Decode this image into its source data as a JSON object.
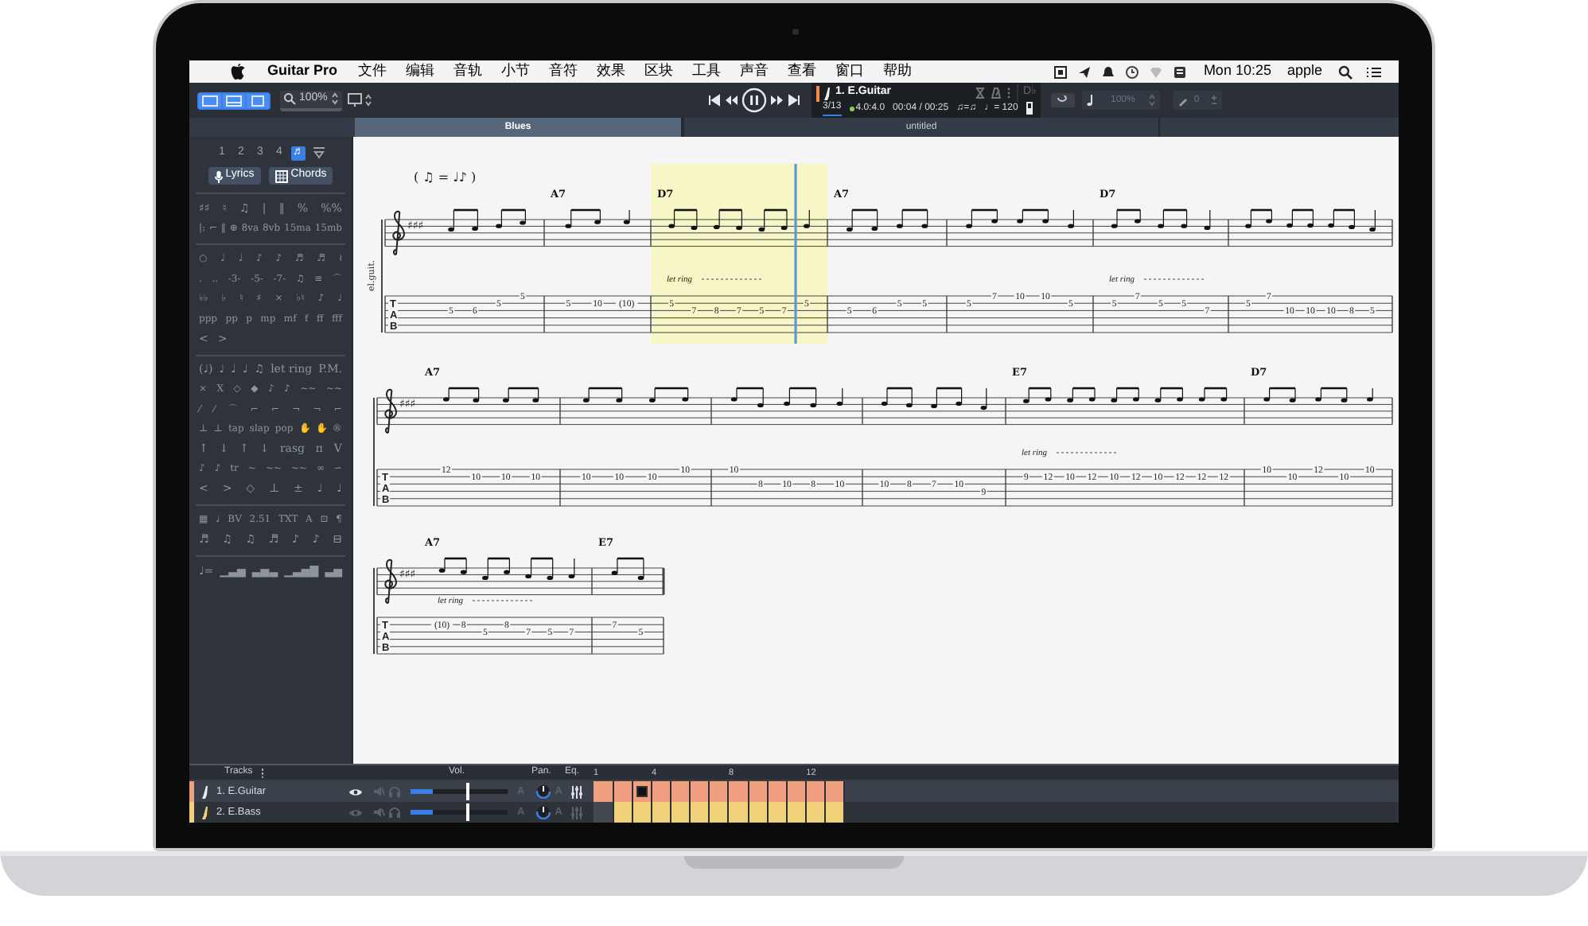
{
  "menubar": {
    "menus": [
      {
        "label": "Guitar Pro",
        "kind": "app"
      },
      {
        "label": "文件",
        "kind": "menu"
      },
      {
        "label": "编辑",
        "kind": "menu"
      },
      {
        "label": "音轨",
        "kind": "menu"
      },
      {
        "label": "小节",
        "kind": "menu"
      },
      {
        "label": "音符",
        "kind": "menu"
      },
      {
        "label": "效果",
        "kind": "menu"
      },
      {
        "label": "区块",
        "kind": "menu"
      },
      {
        "label": "工具",
        "kind": "menu"
      },
      {
        "label": "声音",
        "kind": "menu"
      },
      {
        "label": "查看",
        "kind": "menu"
      },
      {
        "label": "窗口",
        "kind": "menu"
      },
      {
        "label": "帮助",
        "kind": "menu"
      }
    ],
    "clock": "Mon 10:25",
    "user": "apple"
  },
  "toolbar": {
    "zoom": "100%",
    "track": {
      "name": "1. E.Guitar",
      "bar": "3/13",
      "signature": "4.0:4.0",
      "time": "00:04 / 00:25",
      "feel": "♫=♫",
      "tempo": "♩= 120",
      "key": "D♭"
    },
    "speed": "100%",
    "pitch": "0"
  },
  "tabs": [
    {
      "label": "Blues",
      "selected": true
    },
    {
      "label": "untitled",
      "selected": false
    }
  ],
  "palette": {
    "voices": [
      {
        "label": "1",
        "selected": false
      },
      {
        "label": "2",
        "selected": false
      },
      {
        "label": "3",
        "selected": false
      },
      {
        "label": "4",
        "selected": false
      },
      {
        "label": "♬",
        "selected": true
      }
    ],
    "buttons": [
      "Lyrics",
      "Chords"
    ],
    "groups": [
      [
        [
          "♯♯",
          "♮",
          "♫",
          "|",
          "‖",
          "%",
          "%%"
        ],
        [
          "|:",
          "⌐",
          "‖",
          "⊕",
          "8va",
          "8vb",
          "15ma",
          "15mb"
        ]
      ],
      [
        [
          "○",
          "♩",
          "♩",
          "♪",
          "♪",
          "♬",
          "♬",
          "≀"
        ],
        [
          ".",
          "..",
          "-3-",
          "-5-",
          "-7-",
          "♫",
          "≡",
          "⌒"
        ],
        [
          "♭♭",
          "♭",
          "♮",
          "♯",
          "×",
          "♭♮",
          "♪",
          "♩"
        ],
        [
          "ppp",
          "pp",
          "p",
          "mp",
          "mf",
          "f",
          "ff",
          "fff"
        ],
        [
          "<",
          ">"
        ]
      ],
      [
        [
          "(♩)",
          "♩",
          "♩",
          "♩",
          "♫",
          "let ring",
          "P.M."
        ],
        [
          "×",
          "X",
          "◇",
          "◆",
          "♪",
          "♪",
          "~~",
          "~~"
        ],
        [
          "⁄",
          "⁄",
          "⌒",
          "⌐",
          "⌐",
          "¬",
          "¬",
          "⌐"
        ],
        [
          "⊥",
          "⊥",
          "tap",
          "slap",
          "pop",
          "✋",
          "✋",
          "®"
        ],
        [
          "↑",
          "↓",
          "↑",
          "↓",
          "rasg",
          "п",
          "V"
        ],
        [
          "♪",
          "♪",
          "tr",
          "~",
          "~~",
          "~~",
          "∞",
          "∽"
        ],
        [
          "<",
          ">",
          "◇",
          "⊥",
          "±",
          "♩",
          "♩"
        ]
      ],
      [
        [
          "▦",
          "♩",
          "BV",
          "2.51",
          "TXT",
          "A",
          "⊡",
          "¶"
        ],
        [
          "♬",
          "♫",
          "♫",
          "♬",
          "♪",
          "♪",
          "⊟"
        ]
      ],
      [
        [
          "♩=",
          "▁▃▅",
          "▃▅▃",
          "▁▃▅▇",
          "▃▅"
        ]
      ]
    ]
  },
  "score": {
    "swing_mark": "( ♫ = ♩♪ )",
    "instrument_label": "el.guit.",
    "systems": [
      {
        "key_signature": "♯♯♯",
        "tab_clef": [
          "T",
          "A",
          "B"
        ],
        "measures": [
          {
            "selected": false,
            "playhead": false,
            "notes": [
              {
                "kind": "third",
                "fret": "5"
              },
              {
                "kind": "third",
                "fret": "6"
              },
              {
                "kind": "second",
                "fret": "5"
              },
              {
                "kind": "first",
                "fret": "5"
              }
            ]
          },
          {
            "chord": "A7",
            "selected": false,
            "playhead": false,
            "notes": [
              {
                "kind": "second",
                "fret": "5"
              },
              {
                "kind": "second",
                "fret": "10"
              },
              {
                "kind": "second",
                "fret": "(10)"
              }
            ]
          },
          {
            "chord": "D7",
            "annotation": "let ring",
            "selected": true,
            "playhead": true,
            "notes": [
              {
                "kind": "second",
                "fret": "5"
              },
              {
                "kind": "third",
                "fret": "7"
              },
              {
                "kind": "third",
                "fret": "8"
              },
              {
                "kind": "third",
                "fret": "7"
              },
              {
                "kind": "third",
                "fret": "5"
              },
              {
                "kind": "third",
                "fret": "7"
              },
              {
                "kind": "second",
                "fret": "5"
              }
            ]
          },
          {
            "chord": "A7",
            "selected": false,
            "playhead": false,
            "notes": [
              {
                "kind": "third",
                "fret": "5"
              },
              {
                "kind": "third",
                "fret": "6"
              },
              {
                "kind": "second",
                "fret": "5"
              },
              {
                "kind": "second",
                "fret": "5"
              }
            ]
          },
          {
            "selected": false,
            "playhead": false,
            "notes": [
              {
                "kind": "second",
                "fret": "5"
              },
              {
                "kind": "first",
                "fret": "7"
              },
              {
                "kind": "first",
                "fret": "10"
              },
              {
                "kind": "first",
                "fret": "10"
              },
              {
                "kind": "second",
                "fret": "5"
              }
            ]
          },
          {
            "chord": "D7",
            "annotation": "let ring",
            "selected": false,
            "playhead": false,
            "notes": [
              {
                "kind": "second",
                "fret": "5"
              },
              {
                "kind": "first",
                "fret": "7"
              },
              {
                "kind": "second",
                "fret": "5"
              },
              {
                "kind": "second",
                "fret": "5"
              },
              {
                "kind": "third",
                "fret": "7"
              }
            ]
          },
          {
            "selected": false,
            "playhead": false,
            "notes": [
              {
                "kind": "second",
                "fret": "5"
              },
              {
                "kind": "first",
                "fret": "7"
              },
              {
                "kind": "third",
                "fret": "10"
              },
              {
                "kind": "third",
                "fret": "10"
              },
              {
                "kind": "third",
                "fret": "10"
              },
              {
                "kind": "third",
                "fret": "8"
              },
              {
                "kind": "third",
                "fret": "5"
              }
            ]
          }
        ]
      },
      {
        "key_signature": "♯♯♯",
        "tab_clef": [
          "T",
          "A",
          "B"
        ],
        "measures": [
          {
            "chord": "A7",
            "selected": false,
            "playhead": false,
            "notes": [
              {
                "kind": "first",
                "fret": "12"
              },
              {
                "kind": "second",
                "fret": "10"
              },
              {
                "kind": "second",
                "fret": "10"
              },
              {
                "kind": "second",
                "fret": "10"
              }
            ]
          },
          {
            "selected": false,
            "playhead": false,
            "notes": [
              {
                "kind": "second",
                "fret": "10"
              },
              {
                "kind": "second",
                "fret": "10"
              },
              {
                "kind": "second",
                "fret": "10"
              },
              {
                "kind": "first",
                "fret": "10"
              }
            ]
          },
          {
            "selected": false,
            "playhead": false,
            "notes": [
              {
                "kind": "first",
                "fret": "10"
              },
              {
                "kind": "third",
                "fret": "8"
              },
              {
                "kind": "third",
                "fret": "10"
              },
              {
                "kind": "third",
                "fret": "8"
              },
              {
                "kind": "third",
                "fret": "10"
              }
            ]
          },
          {
            "selected": false,
            "playhead": false,
            "notes": [
              {
                "kind": "third",
                "fret": "10"
              },
              {
                "kind": "third",
                "fret": "8"
              },
              {
                "kind": "third",
                "fret": "7"
              },
              {
                "kind": "third",
                "fret": "10"
              },
              {
                "kind": "fourth",
                "fret": "9"
              }
            ]
          },
          {
            "chord": "E7",
            "annotation": "let ring",
            "selected": false,
            "playhead": false,
            "notes": [
              {
                "kind": "second",
                "fret": "9"
              },
              {
                "kind": "second",
                "fret": "12"
              },
              {
                "kind": "second",
                "fret": "10"
              },
              {
                "kind": "second",
                "fret": "12"
              },
              {
                "kind": "second",
                "fret": "10"
              },
              {
                "kind": "second",
                "fret": "12"
              },
              {
                "kind": "second",
                "fret": "10"
              },
              {
                "kind": "second",
                "fret": "12"
              },
              {
                "kind": "second",
                "fret": "12"
              },
              {
                "kind": "second",
                "fret": "12"
              }
            ]
          },
          {
            "chord": "D7",
            "selected": false,
            "playhead": false,
            "notes": [
              {
                "kind": "first",
                "fret": "10"
              },
              {
                "kind": "second",
                "fret": "10"
              },
              {
                "kind": "first",
                "fret": "12"
              },
              {
                "kind": "second",
                "fret": "10"
              },
              {
                "kind": "first",
                "fret": "10"
              }
            ]
          }
        ]
      },
      {
        "key_signature": "♯♯♯",
        "tab_clef": [
          "T",
          "A",
          "B"
        ],
        "measures": [
          {
            "chord": "A7",
            "annotation": "let ring",
            "selected": false,
            "playhead": false,
            "notes": [
              {
                "kind": "second",
                "fret": "(10)"
              },
              {
                "kind": "second",
                "fret": "8"
              },
              {
                "kind": "third",
                "fret": "5"
              },
              {
                "kind": "second",
                "fret": "8"
              },
              {
                "kind": "third",
                "fret": "7"
              },
              {
                "kind": "third",
                "fret": "5"
              },
              {
                "kind": "third",
                "fret": "7"
              }
            ]
          },
          {
            "chord": "E7",
            "selected": false,
            "playhead": false,
            "notes": [
              {
                "kind": "second",
                "fret": "7"
              },
              {
                "kind": "third",
                "fret": "5"
              }
            ]
          }
        ]
      }
    ]
  },
  "tracks_panel": {
    "title": "Tracks",
    "columns": [
      "Vol.",
      "Pan.",
      "Eq."
    ],
    "bar_numbers": [
      "1",
      "4",
      "8",
      "12"
    ],
    "tracks": [
      {
        "name": "1. E.Guitar",
        "color": "#f0a07e",
        "selected": true,
        "visible": true,
        "volume": {
          "level": 0.59
        },
        "pan": "A",
        "volume_auto": "A",
        "bars": [
          {
            "filled": true,
            "current": false
          },
          {
            "filled": true,
            "current": false
          },
          {
            "filled": true,
            "current": true
          },
          {
            "filled": true,
            "current": false
          },
          {
            "filled": true,
            "current": false
          },
          {
            "filled": true,
            "current": false
          },
          {
            "filled": true,
            "current": false
          },
          {
            "filled": true,
            "current": false
          },
          {
            "filled": true,
            "current": false
          },
          {
            "filled": true,
            "current": false
          },
          {
            "filled": true,
            "current": false
          },
          {
            "filled": true,
            "current": false
          },
          {
            "filled": true,
            "current": false
          }
        ]
      },
      {
        "name": "2. E.Bass",
        "color": "#f1d27a",
        "selected": false,
        "visible": false,
        "volume": {
          "level": 0.59
        },
        "pan": "A",
        "volume_auto": "A",
        "bars": [
          {
            "filled": false,
            "current": false
          },
          {
            "filled": true,
            "current": false
          },
          {
            "filled": true,
            "current": false
          },
          {
            "filled": true,
            "current": false
          },
          {
            "filled": true,
            "current": false
          },
          {
            "filled": true,
            "current": false
          },
          {
            "filled": true,
            "current": false
          },
          {
            "filled": true,
            "current": false
          },
          {
            "filled": true,
            "current": false
          },
          {
            "filled": true,
            "current": false
          },
          {
            "filled": true,
            "current": false
          },
          {
            "filled": true,
            "current": false
          },
          {
            "filled": true,
            "current": false
          }
        ]
      }
    ]
  }
}
